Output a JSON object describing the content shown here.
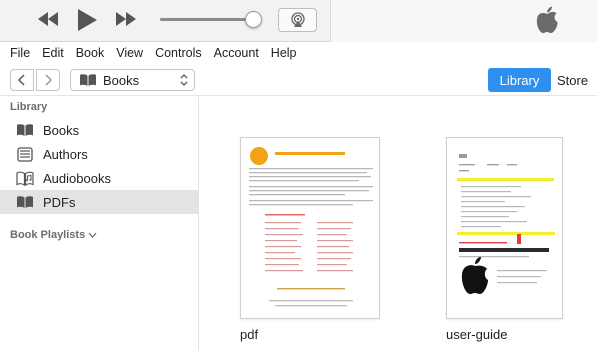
{
  "player": {
    "controls": [
      "rewind",
      "play",
      "fast-forward"
    ],
    "volume": 0.9
  },
  "menu": [
    "File",
    "Edit",
    "Book",
    "View",
    "Controls",
    "Account",
    "Help"
  ],
  "nav": {
    "media_kind": "Books"
  },
  "tabs": {
    "library": "Library",
    "store": "Store"
  },
  "sidebar": {
    "section_title": "Library",
    "items": [
      {
        "label": "Books",
        "icon": "book-icon"
      },
      {
        "label": "Authors",
        "icon": "authors-icon"
      },
      {
        "label": "Audiobooks",
        "icon": "audiobook-icon"
      },
      {
        "label": "PDFs",
        "icon": "book-icon"
      }
    ],
    "selected": "PDFs",
    "playlists_title": "Book Playlists"
  },
  "content": {
    "books": [
      {
        "title": "pdf"
      },
      {
        "title": "user-guide"
      }
    ]
  },
  "colors": {
    "accent": "#2d8ff0",
    "selection": "#e3e3e3"
  }
}
